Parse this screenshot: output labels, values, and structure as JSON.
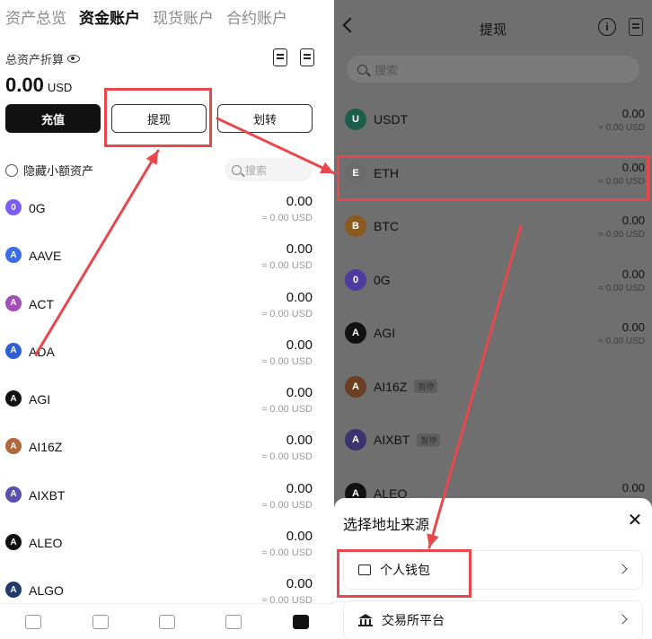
{
  "left": {
    "tabs": [
      "资产总览",
      "资金账户",
      "现货账户",
      "合约账户"
    ],
    "total_label": "总资产折算",
    "balance": "0.00",
    "currency": "USD",
    "buttons": {
      "deposit": "充值",
      "withdraw": "提现",
      "transfer": "划转"
    },
    "hide_small": "隐藏小额资产",
    "search_placeholder": "搜索",
    "assets": [
      {
        "name": "0G",
        "value": "0.00",
        "usd": "≈ 0.00 USD",
        "color": "#7b5cf5"
      },
      {
        "name": "AAVE",
        "value": "0.00",
        "usd": "≈ 0.00 USD",
        "color": "#3a6ee8"
      },
      {
        "name": "ACT",
        "value": "0.00",
        "usd": "≈ 0.00 USD",
        "color": "#a24db8"
      },
      {
        "name": "ADA",
        "value": "0.00",
        "usd": "≈ 0.00 USD",
        "color": "#2d5fd6"
      },
      {
        "name": "AGI",
        "value": "0.00",
        "usd": "≈ 0.00 USD",
        "color": "#111111"
      },
      {
        "name": "AI16Z",
        "value": "0.00",
        "usd": "≈ 0.00 USD",
        "color": "#b0673a"
      },
      {
        "name": "AIXBT",
        "value": "0.00",
        "usd": "≈ 0.00 USD",
        "color": "#5a4fb0"
      },
      {
        "name": "ALEO",
        "value": "0.00",
        "usd": "≈ 0.00 USD",
        "color": "#111111"
      },
      {
        "name": "ALGO",
        "value": "0.00",
        "usd": "≈ 0.00 USD",
        "color": "#1f3a6b"
      }
    ]
  },
  "right": {
    "title": "提现",
    "search_placeholder": "搜索",
    "coins": [
      {
        "name": "USDT",
        "value": "0.00",
        "usd": "≈ 0.00 USD",
        "color": "#1a5e4a",
        "badge": ""
      },
      {
        "name": "ETH",
        "value": "0.00",
        "usd": "≈ 0.00 USD",
        "color": "#6b6b6b",
        "badge": ""
      },
      {
        "name": "BTC",
        "value": "0.00",
        "usd": "≈ 0.00 USD",
        "color": "#8a5a1e",
        "badge": ""
      },
      {
        "name": "0G",
        "value": "0.00",
        "usd": "≈ 0.00 USD",
        "color": "#4f3aa0",
        "badge": ""
      },
      {
        "name": "AGI",
        "value": "0.00",
        "usd": "≈ 0.00 USD",
        "color": "#111111",
        "badge": ""
      },
      {
        "name": "AI16Z",
        "value": "",
        "usd": "",
        "color": "#6a3f22",
        "badge": "暂停"
      },
      {
        "name": "AIXBT",
        "value": "",
        "usd": "",
        "color": "#3a3370",
        "badge": "暂停"
      },
      {
        "name": "ALEO",
        "value": "0.00",
        "usd": "",
        "color": "#111111",
        "badge": ""
      }
    ],
    "sheet": {
      "title": "选择地址来源",
      "option_wallet": "个人钱包",
      "option_exchange": "交易所平台"
    }
  },
  "annotation_color": "#e8474b"
}
